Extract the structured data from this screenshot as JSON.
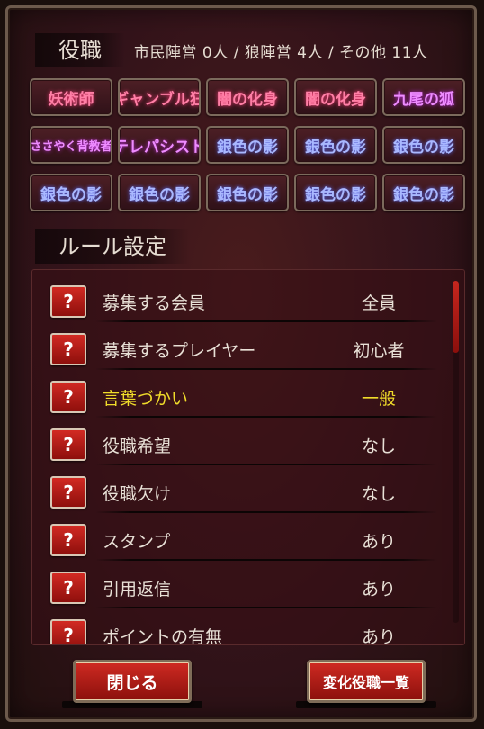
{
  "roles_section": {
    "title": "役職",
    "camp_summary": "市民陣営 0人 / 狼陣営 4人 / その他 11人",
    "roles": [
      {
        "label": "妖術師",
        "color": "pink"
      },
      {
        "label": "ギャンブル狂",
        "color": "pink"
      },
      {
        "label": "闇の化身",
        "color": "pink"
      },
      {
        "label": "闇の化身",
        "color": "pink"
      },
      {
        "label": "九尾の狐",
        "color": "magenta"
      },
      {
        "label": "ささやく背教者",
        "color": "magenta"
      },
      {
        "label": "テレパシスト",
        "color": "magenta"
      },
      {
        "label": "銀色の影",
        "color": "blue"
      },
      {
        "label": "銀色の影",
        "color": "blue"
      },
      {
        "label": "銀色の影",
        "color": "blue"
      },
      {
        "label": "銀色の影",
        "color": "blue"
      },
      {
        "label": "銀色の影",
        "color": "blue"
      },
      {
        "label": "銀色の影",
        "color": "blue"
      },
      {
        "label": "銀色の影",
        "color": "blue"
      },
      {
        "label": "銀色の影",
        "color": "blue"
      }
    ]
  },
  "rules_section": {
    "title": "ルール設定",
    "help_icon_label": "?",
    "rules": [
      {
        "label": "募集する会員",
        "value": "全員",
        "highlight": false
      },
      {
        "label": "募集するプレイヤー",
        "value": "初心者",
        "highlight": false
      },
      {
        "label": "言葉づかい",
        "value": "一般",
        "highlight": true
      },
      {
        "label": "役職希望",
        "value": "なし",
        "highlight": false
      },
      {
        "label": "役職欠け",
        "value": "なし",
        "highlight": false
      },
      {
        "label": "スタンプ",
        "value": "あり",
        "highlight": false
      },
      {
        "label": "引用返信",
        "value": "あり",
        "highlight": false
      },
      {
        "label": "ポイントの有無",
        "value": "あり",
        "highlight": false
      }
    ]
  },
  "footer": {
    "close_label": "閉じる",
    "role_list_label": "変化役職一覧"
  },
  "colors": {
    "highlight_text": "#f0dc2a",
    "button_red": "#c7261e"
  }
}
